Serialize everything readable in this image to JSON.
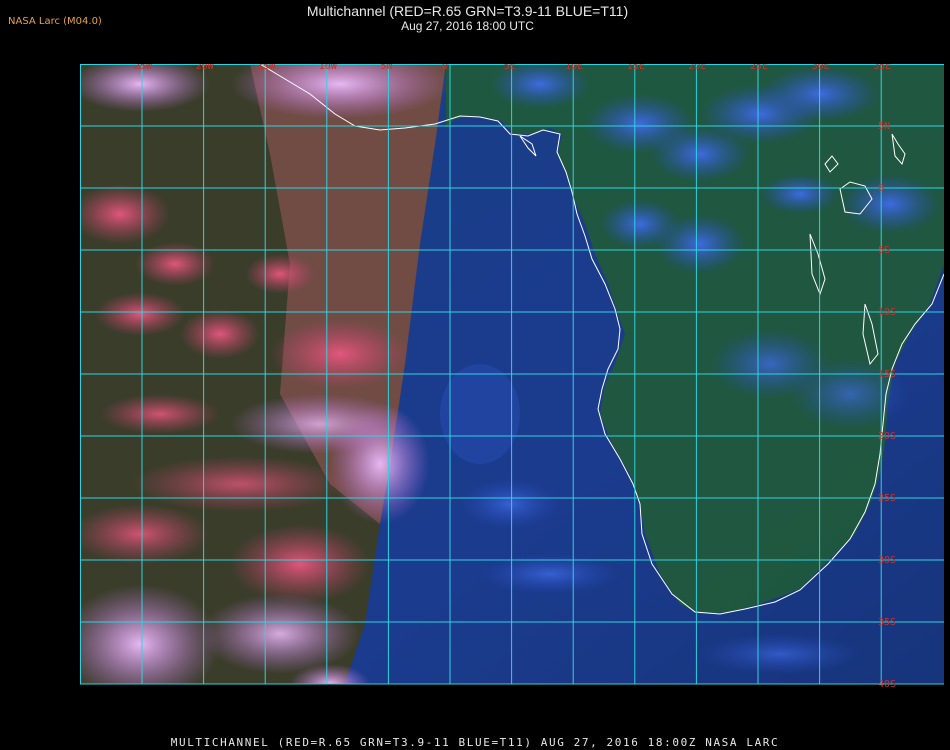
{
  "brand_label": "NASA Larc (M04.0)",
  "title": "Multichannel (RED=R.65 GRN=T3.9-11 BLUE=T11)",
  "subtitle": "Aug 27, 2016 18:00 UTC",
  "footer": "MULTICHANNEL (RED=R.65 GRN=T3.9-11 BLUE=T11) AUG 27, 2016 18:00Z NASA LARC",
  "longitude_labels": [
    "25W",
    "20W",
    "15W",
    "10W",
    "5W",
    "0",
    "5E",
    "10E",
    "15E",
    "20E",
    "25E",
    "30E",
    "35E"
  ],
  "latitude_labels": [
    "5N",
    "0",
    "5S",
    "10S",
    "15S",
    "20S",
    "25S",
    "30S",
    "35S",
    "40S"
  ],
  "colors": {
    "grid": "#2fd3e0",
    "grid_label": "#c8342a",
    "coastline": "#ffffff",
    "ocean": "#1b3a86",
    "land": "#1f5a3a",
    "cloud_warm": "#e0507a",
    "cloud_high": "#c47ae6",
    "brand": "#e8a24a"
  }
}
